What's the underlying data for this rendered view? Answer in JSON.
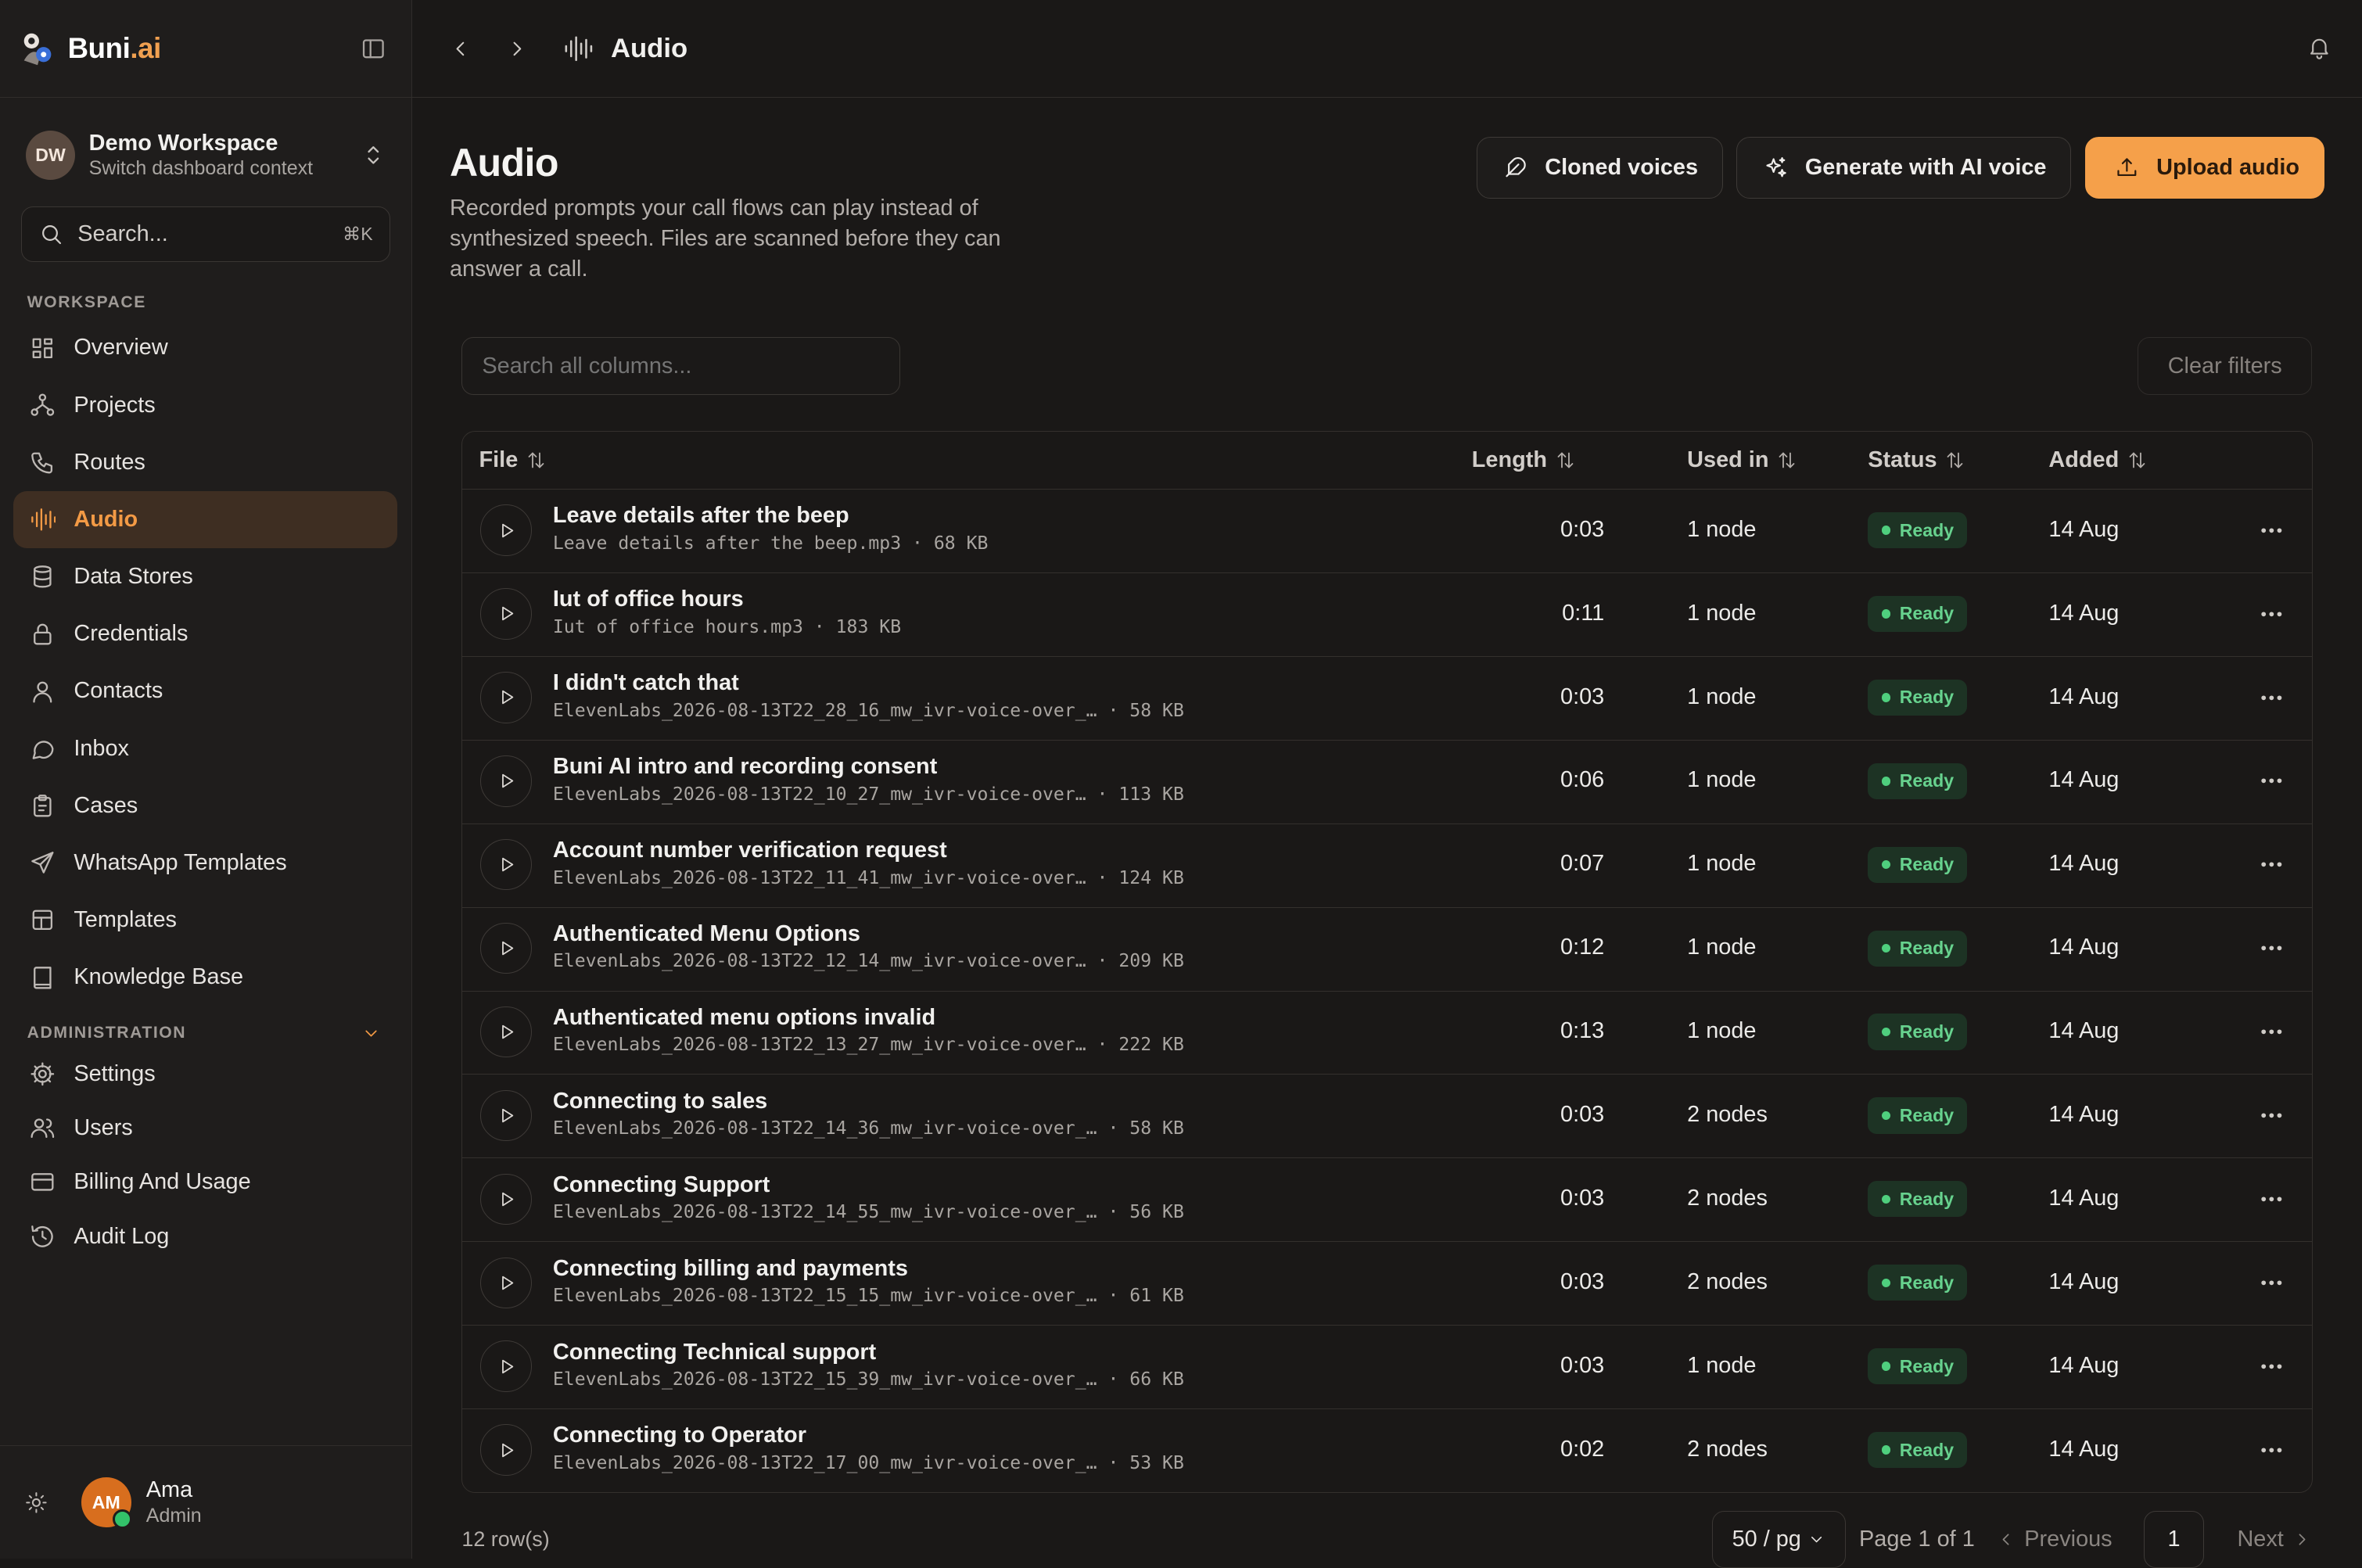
{
  "brand": {
    "name": "Buni",
    "tld": ".ai"
  },
  "workspace": {
    "initials": "DW",
    "name": "Demo Workspace",
    "subtitle": "Switch dashboard context"
  },
  "search": {
    "placeholder": "Search...",
    "shortcut": "⌘K"
  },
  "sections": {
    "workspace": "WORKSPACE",
    "administration": "ADMINISTRATION"
  },
  "nav": [
    {
      "label": "Overview",
      "icon": "dashboard-icon"
    },
    {
      "label": "Projects",
      "icon": "projects-icon"
    },
    {
      "label": "Routes",
      "icon": "phone-icon"
    },
    {
      "label": "Audio",
      "icon": "audio-wave-icon",
      "active": true
    },
    {
      "label": "Data Stores",
      "icon": "database-icon"
    },
    {
      "label": "Credentials",
      "icon": "lock-icon"
    },
    {
      "label": "Contacts",
      "icon": "user-icon"
    },
    {
      "label": "Inbox",
      "icon": "chat-bubble-icon"
    },
    {
      "label": "Cases",
      "icon": "clipboard-icon"
    },
    {
      "label": "WhatsApp Templates",
      "icon": "send-icon"
    },
    {
      "label": "Templates",
      "icon": "layout-icon"
    },
    {
      "label": "Knowledge Base",
      "icon": "book-icon"
    }
  ],
  "admin_nav": [
    {
      "label": "Settings",
      "icon": "gear-icon"
    },
    {
      "label": "Users",
      "icon": "users-icon"
    },
    {
      "label": "Billing And Usage",
      "icon": "credit-card-icon"
    },
    {
      "label": "Audit Log",
      "icon": "history-icon"
    }
  ],
  "user": {
    "initials": "AM",
    "name": "Ama",
    "role": "Admin"
  },
  "topbar": {
    "title": "Audio"
  },
  "page": {
    "title": "Audio",
    "description": "Recorded prompts your call flows can play instead of synthesized speech. Files are scanned before they can answer a call."
  },
  "actions": {
    "cloned": "Cloned voices",
    "generate": "Generate with AI voice",
    "upload": "Upload audio"
  },
  "filters": {
    "search_placeholder": "Search all columns...",
    "clear": "Clear filters"
  },
  "columns": {
    "file": "File",
    "length": "Length",
    "used_in": "Used in",
    "status": "Status",
    "added": "Added"
  },
  "rows": [
    {
      "name": "Leave details after the beep",
      "file": "Leave details after the beep.mp3",
      "size": "68 KB",
      "length": "0:03",
      "used_in": "1 node",
      "status": "Ready",
      "added": "14 Aug"
    },
    {
      "name": "Iut of office hours",
      "file": "Iut of office hours.mp3",
      "size": "183 KB",
      "length": "0:11",
      "used_in": "1 node",
      "status": "Ready",
      "added": "14 Aug"
    },
    {
      "name": "I didn't catch that",
      "file": "ElevenLabs_2026-08-13T22_28_16_mw_ivr-voice-over_…",
      "size": "58 KB",
      "length": "0:03",
      "used_in": "1 node",
      "status": "Ready",
      "added": "14 Aug"
    },
    {
      "name": "Buni AI intro and recording consent",
      "file": "ElevenLabs_2026-08-13T22_10_27_mw_ivr-voice-over…",
      "size": "113 KB",
      "length": "0:06",
      "used_in": "1 node",
      "status": "Ready",
      "added": "14 Aug"
    },
    {
      "name": "Account number verification request",
      "file": "ElevenLabs_2026-08-13T22_11_41_mw_ivr-voice-over…",
      "size": "124 KB",
      "length": "0:07",
      "used_in": "1 node",
      "status": "Ready",
      "added": "14 Aug"
    },
    {
      "name": "Authenticated Menu Options",
      "file": "ElevenLabs_2026-08-13T22_12_14_mw_ivr-voice-over…",
      "size": "209 KB",
      "length": "0:12",
      "used_in": "1 node",
      "status": "Ready",
      "added": "14 Aug"
    },
    {
      "name": "Authenticated menu options invalid",
      "file": "ElevenLabs_2026-08-13T22_13_27_mw_ivr-voice-over…",
      "size": "222 KB",
      "length": "0:13",
      "used_in": "1 node",
      "status": "Ready",
      "added": "14 Aug"
    },
    {
      "name": "Connecting to sales",
      "file": "ElevenLabs_2026-08-13T22_14_36_mw_ivr-voice-over_…",
      "size": "58 KB",
      "length": "0:03",
      "used_in": "2 nodes",
      "status": "Ready",
      "added": "14 Aug"
    },
    {
      "name": "Connecting Support",
      "file": "ElevenLabs_2026-08-13T22_14_55_mw_ivr-voice-over_…",
      "size": "56 KB",
      "length": "0:03",
      "used_in": "2 nodes",
      "status": "Ready",
      "added": "14 Aug"
    },
    {
      "name": "Connecting billing and payments",
      "file": "ElevenLabs_2026-08-13T22_15_15_mw_ivr-voice-over_…",
      "size": "61 KB",
      "length": "0:03",
      "used_in": "2 nodes",
      "status": "Ready",
      "added": "14 Aug"
    },
    {
      "name": "Connecting Technical support",
      "file": "ElevenLabs_2026-08-13T22_15_39_mw_ivr-voice-over_…",
      "size": "66 KB",
      "length": "0:03",
      "used_in": "1 node",
      "status": "Ready",
      "added": "14 Aug"
    },
    {
      "name": "Connecting to Operator",
      "file": "ElevenLabs_2026-08-13T22_17_00_mw_ivr-voice-over_…",
      "size": "53 KB",
      "length": "0:02",
      "used_in": "2 nodes",
      "status": "Ready",
      "added": "14 Aug"
    }
  ],
  "footer": {
    "row_count": "12 row(s)",
    "page_size": "50 / pg",
    "page_label": "Page 1 of 1",
    "previous": "Previous",
    "current_page": "1",
    "next": "Next"
  },
  "colors": {
    "accent": "#f5a04a",
    "active_nav": "#f39a45",
    "ready_badge": "#67d28e"
  }
}
